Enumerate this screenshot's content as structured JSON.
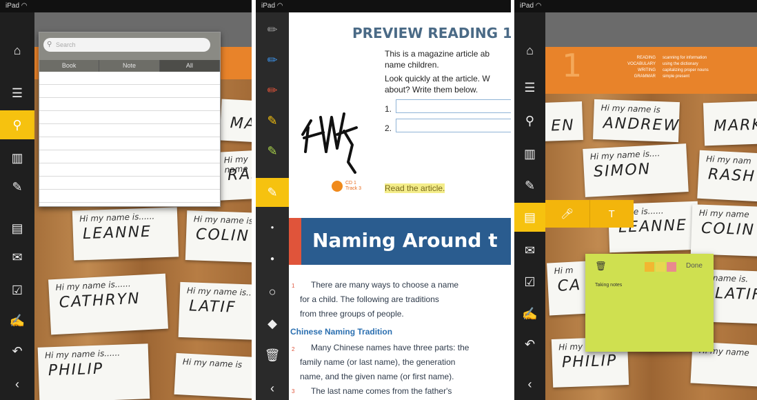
{
  "status_left": "iPad",
  "panel1": {
    "search": {
      "placeholder": "Search",
      "tabs": [
        "Book",
        "Note",
        "All"
      ]
    },
    "cards": [
      {
        "hi": "Hi my name is......",
        "name": "LEANNE"
      },
      {
        "hi": "Hi my name is..",
        "name": "COLIN"
      },
      {
        "hi": "Hi my name is......",
        "name": "CATHRYN"
      },
      {
        "hi": "Hi my name is..",
        "name": "LATIF"
      },
      {
        "hi": "Hi my name is......",
        "name": "PHILIP"
      },
      {
        "hi": "Hi my name is",
        "name": ""
      },
      {
        "hi": "",
        "name": "MARK"
      },
      {
        "hi": "Hi my name",
        "name": "RASH"
      }
    ]
  },
  "panel2": {
    "title": "PREVIEW READING 1",
    "intro1": "This is a magazine article ab",
    "intro2": "name children.",
    "q1": "Look quickly at the article. W",
    "q2": "about? Write them below.",
    "n1": "1.",
    "n2": "2.",
    "handwriting": "HW",
    "cd1": "CD 1",
    "cd2": "Track 3",
    "read": "Read the article.",
    "band_title": "Naming Around t",
    "p1": [
      "There are many ways to choose a name",
      "for a child. The following are traditions",
      "from three groups of people."
    ],
    "sub": "Chinese Naming Tradition",
    "p2": [
      "Many Chinese names have three parts: the",
      "family name (or last name), the generation",
      "name, and the given name (or first name).",
      "The last name comes from the father's"
    ],
    "line_nums": [
      "1",
      "2",
      "3"
    ]
  },
  "panel3": {
    "banner_num": "1",
    "banner_labels": [
      "READING",
      "VOCABULARY",
      "WRITING",
      "GRAMMAR"
    ],
    "banner_values": [
      "scanning for information",
      "using the dictionary",
      "capitalizing proper nouns",
      "simple present"
    ],
    "sticky_done": "Done",
    "sticky_text": "Taking notes",
    "sticky_colors": [
      "#f2b731",
      "#e8d850",
      "#e98a8e"
    ],
    "cards": [
      {
        "hi": "Hi my name is",
        "name": "ANDREW"
      },
      {
        "hi": "",
        "name": "MARK"
      },
      {
        "hi": "Hi my name is....",
        "name": "SIMON"
      },
      {
        "hi": "Hi my nam",
        "name": "RASH"
      },
      {
        "hi": "name is......",
        "name": "LEANNE"
      },
      {
        "hi": "Hi my name",
        "name": "COLIN"
      },
      {
        "hi": "name is.",
        "name": "LATIF"
      },
      {
        "hi": "Hi my",
        "name": "PHILIP"
      },
      {
        "hi": "Hi my name",
        "name": ""
      },
      {
        "hi": "",
        "name": "EN"
      },
      {
        "hi": "Hi m",
        "name": "CA"
      }
    ]
  },
  "colors": {
    "accent": "#f6c20f",
    "toolbar": "#1f1f1f",
    "orange": "#e8832a",
    "sticky": "#cfe050",
    "blue_band": "#2a5c8f"
  }
}
